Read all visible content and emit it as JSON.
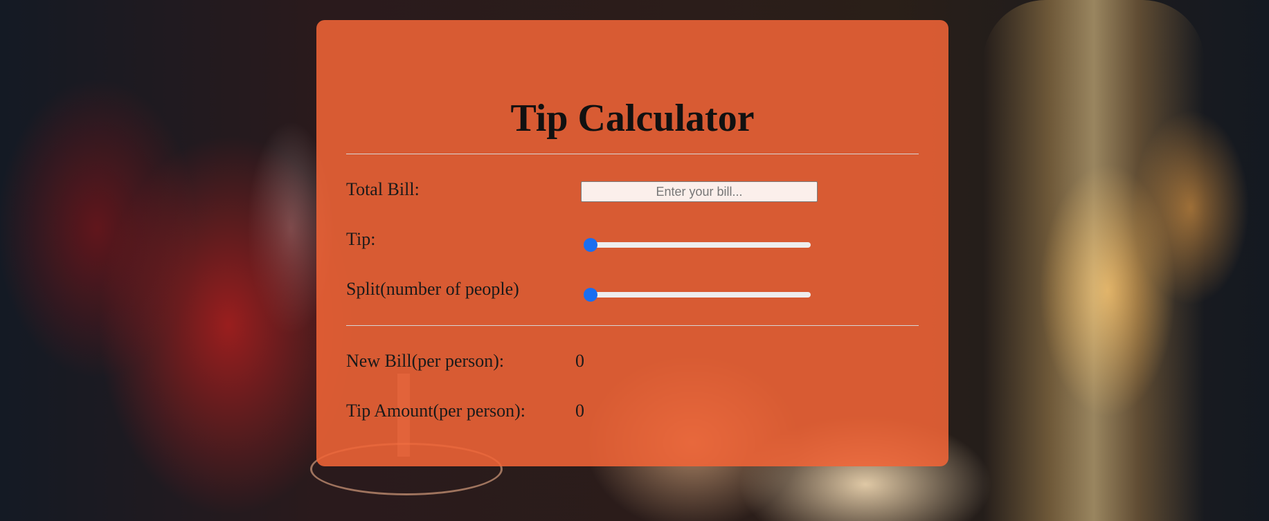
{
  "app": {
    "title": "Tip Calculator"
  },
  "form": {
    "bill_label": "Total Bill:",
    "bill_value": "",
    "bill_placeholder": "Enter your bill...",
    "tip_label": "Tip:",
    "tip_slider_fraction": 0,
    "split_label": "Split(number of people)",
    "split_slider_fraction": 0
  },
  "results": {
    "new_bill_label": "New Bill(per person):",
    "new_bill_value": "0",
    "tip_amount_label": "Tip Amount(per person):",
    "tip_amount_value": "0"
  },
  "colors": {
    "card": "#f06437",
    "slider_thumb": "#1a6ef0",
    "divider": "#d7d7d7"
  }
}
